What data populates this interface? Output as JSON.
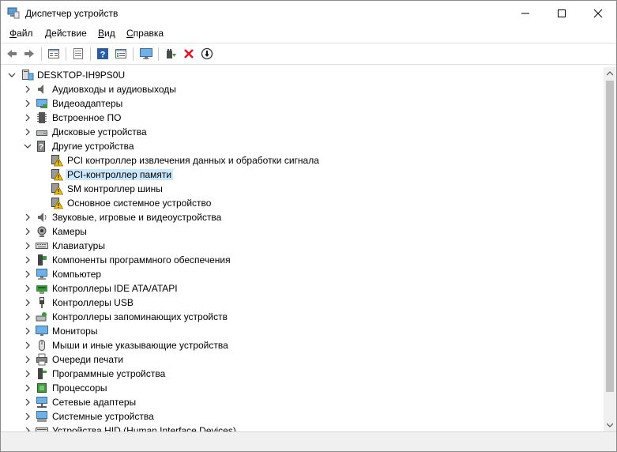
{
  "window": {
    "title": "Диспетчер устройств"
  },
  "menu": {
    "items": [
      {
        "accel": "Ф",
        "rest": "айл"
      },
      {
        "accel": "Д",
        "rest": "ействие"
      },
      {
        "accel": "В",
        "rest": "ид"
      },
      {
        "accel": "С",
        "rest": "правка"
      }
    ]
  },
  "toolbar": {
    "icons": [
      "back-icon",
      "forward-icon",
      "properties-icon",
      "update-list-icon",
      "help-icon",
      "show-hidden-icon",
      "monitor-icon",
      "update-driver-icon",
      "remove-device-icon",
      "disable-device-icon"
    ]
  },
  "tree": {
    "root": "DESKTOP-IH9PS0U",
    "categories": [
      {
        "label": "Аудиовходы и аудиовыходы",
        "icon": "audio-icon"
      },
      {
        "label": "Видеоадаптеры",
        "icon": "display-adapter-icon"
      },
      {
        "label": "Встроенное ПО",
        "icon": "firmware-icon"
      },
      {
        "label": "Дисковые устройства",
        "icon": "disk-icon"
      },
      {
        "label": "Другие устройства",
        "icon": "other-devices-icon",
        "expanded": true,
        "children": [
          "PCI контроллер извлечения данных и обработки сигнала",
          "PCI-контроллер памяти",
          "SM контроллер шины",
          "Основное системное устройство"
        ]
      },
      {
        "label": "Звуковые, игровые и видеоустройства",
        "icon": "sound-icon"
      },
      {
        "label": "Камеры",
        "icon": "camera-icon"
      },
      {
        "label": "Клавиатуры",
        "icon": "keyboard-icon"
      },
      {
        "label": "Компоненты программного обеспечения",
        "icon": "software-component-icon"
      },
      {
        "label": "Компьютер",
        "icon": "computer-icon"
      },
      {
        "label": "Контроллеры IDE ATA/ATAPI",
        "icon": "ide-controller-icon"
      },
      {
        "label": "Контроллеры USB",
        "icon": "usb-icon"
      },
      {
        "label": "Контроллеры запоминающих устройств",
        "icon": "storage-controller-icon"
      },
      {
        "label": "Мониторы",
        "icon": "monitor-icon"
      },
      {
        "label": "Мыши и иные указывающие устройства",
        "icon": "mouse-icon"
      },
      {
        "label": "Очереди печати",
        "icon": "printer-icon"
      },
      {
        "label": "Программные устройства",
        "icon": "software-device-icon"
      },
      {
        "label": "Процессоры",
        "icon": "processor-icon"
      },
      {
        "label": "Сетевые адаптеры",
        "icon": "network-adapter-icon"
      },
      {
        "label": "Системные устройства",
        "icon": "system-devices-icon"
      },
      {
        "label": "Устройства HID (Human Interface Devices)",
        "icon": "hid-icon"
      }
    ],
    "selected_child": "PCI-контроллер памяти"
  },
  "colors": {
    "selection": "#cce8ff",
    "warning": "#f2c200",
    "remove": "#e81123"
  }
}
